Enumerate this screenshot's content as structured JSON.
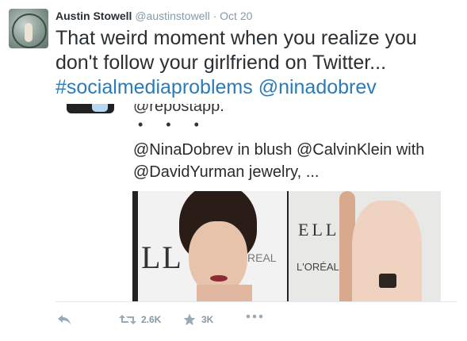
{
  "tweet": {
    "author_name": "Austin Stowell",
    "handle": "@austinstowell",
    "separator": "·",
    "time": "Oct 20",
    "text_part1": "That weird moment when you realize you don't follow your girlfriend on Twitter...",
    "hashtag": "#socialmediaproblems",
    "mention": "@ninadobrev"
  },
  "embedded_image": {
    "handle_fragment": "@repostapp.",
    "dots": "• • •",
    "caption": "@NinaDobrev in blush @CalvinKlein with @DavidYurman jewelry, ...",
    "left_logo": "LL",
    "left_oreal": "REAL",
    "right_logo": "ELLE",
    "right_oreal": "L'ORÉAL"
  },
  "actions": {
    "retweet_count": "2.6K",
    "favorite_count": "3K"
  },
  "icons": [
    "reply-icon",
    "retweet-icon",
    "favorite-icon",
    "more-icon"
  ],
  "colors": {
    "link": "#2b7bb9",
    "meta": "#8899a6",
    "text": "#292f33"
  }
}
